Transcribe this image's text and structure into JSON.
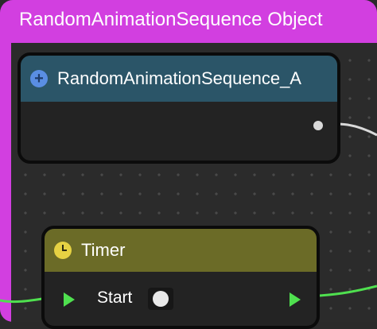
{
  "group": {
    "title": "RandomAnimationSequence Object",
    "color": "#d23fe0"
  },
  "node_random": {
    "title": "RandomAnimationSequence_A",
    "icon": "plus-circle-icon",
    "header_color": "#2b5568"
  },
  "node_timer": {
    "title": "Timer",
    "icon": "clock-icon",
    "header_color": "#6b6b27",
    "pins": {
      "start_label": "Start"
    }
  },
  "colors": {
    "exec_wire": "#4fe04f",
    "data_wire": "#d9d9d9",
    "canvas": "#2b2b2b"
  }
}
